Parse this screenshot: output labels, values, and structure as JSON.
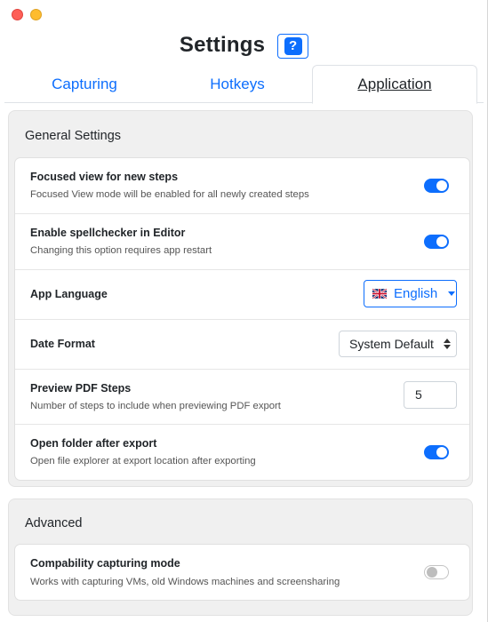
{
  "window": {
    "title": "Settings",
    "help_label": "?"
  },
  "tabs": [
    {
      "label": "Capturing",
      "active": false
    },
    {
      "label": "Hotkeys",
      "active": false
    },
    {
      "label": "Application",
      "active": true
    }
  ],
  "general": {
    "title": "General Settings",
    "focused_view": {
      "label": "Focused view for new steps",
      "description": "Focused View mode will be enabled for all newly created steps",
      "enabled": true
    },
    "spellchecker": {
      "label": "Enable spellchecker in Editor",
      "description": "Changing this option requires app restart",
      "enabled": true
    },
    "language": {
      "label": "App Language",
      "value": "English",
      "flag_icon": "uk-flag-icon"
    },
    "date_format": {
      "label": "Date Format",
      "value": "System Default"
    },
    "preview_pdf": {
      "label": "Preview PDF Steps",
      "description": "Number of steps to include when previewing PDF export",
      "value": "5"
    },
    "open_folder": {
      "label": "Open folder after export",
      "description": "Open file explorer at export location after exporting",
      "enabled": true
    }
  },
  "advanced": {
    "title": "Advanced",
    "compat_mode": {
      "label": "Compability capturing mode",
      "description": "Works with capturing VMs, old Windows machines and screensharing",
      "enabled": false
    }
  },
  "colors": {
    "accent": "#0d6efd",
    "panel_bg": "#f0f0f0",
    "close": "#fe5f57",
    "minimize": "#febc2e"
  }
}
